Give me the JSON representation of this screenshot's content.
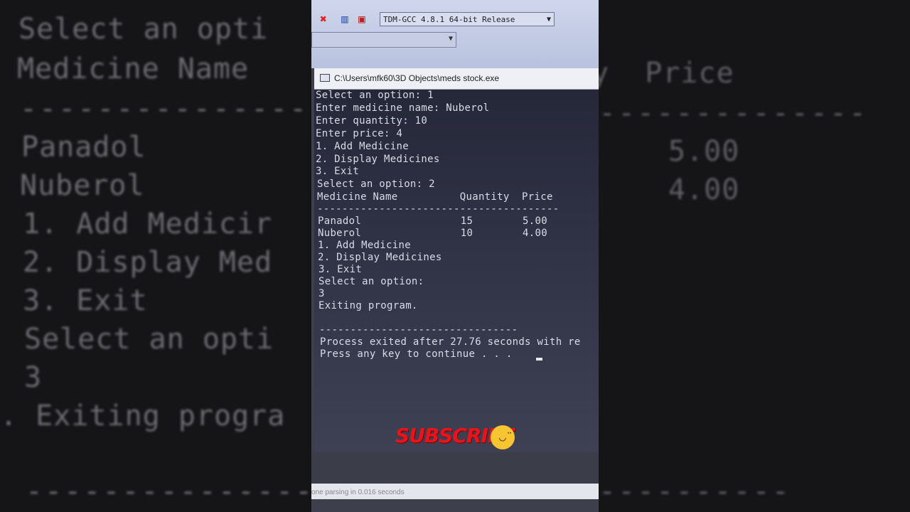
{
  "left_blur": {
    "lines": [
      "Select an opti",
      "Medicine Name",
      "----------------",
      "Panadol",
      "Nuberol",
      "1. Add Medicir",
      "2. Display Med",
      "3. Exit",
      "Select an opti",
      "3",
      ". Exiting progra",
      "----------------"
    ]
  },
  "right_blur": {
    "lines": [
      "y  Price",
      "--------------",
      "5.00",
      "4.00",
      "----------"
    ]
  },
  "ide": {
    "compiler": "TDM-GCC 4.8.1 64-bit Release",
    "toolbar_icons": [
      "close-icon",
      "chart-icon",
      "debug-icon"
    ],
    "status_text": "one parsing in 0.016 seconds"
  },
  "console": {
    "title": "C:\\Users\\mfk60\\3D Objects\\meds stock.exe",
    "lines": [
      "Select an option: 1",
      "Enter medicine name: Nuberol",
      "Enter quantity: 10",
      "Enter price: 4",
      "1. Add Medicine",
      "2. Display Medicines",
      "3. Exit",
      "Select an option: 2",
      "Medicine Name          Quantity  Price",
      "---------------------------------------",
      "Panadol                15        5.00",
      "Nuberol                10        4.00",
      "1. Add Medicine",
      "2. Display Medicines",
      "3. Exit",
      "Select an option:",
      "3",
      "Exiting program.",
      "",
      "--------------------------------",
      "Process exited after 27.76 seconds with re",
      "Press any key to continue . . ."
    ]
  },
  "overlay": {
    "subscribe": "SUBSCRIBE",
    "emoji": "upside-down-face"
  }
}
